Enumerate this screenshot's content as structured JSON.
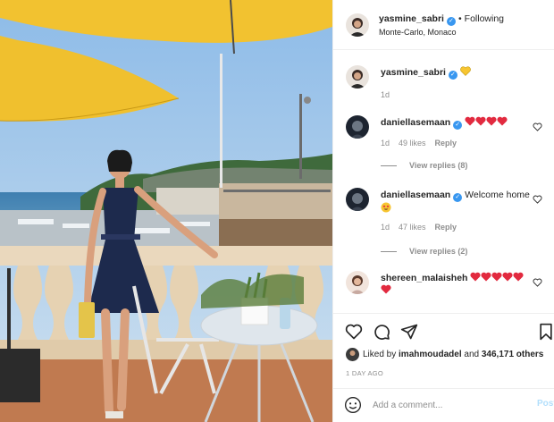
{
  "post": {
    "author": "yasmine_sabri",
    "following_label": "Following",
    "location": "Monte-Carlo, Monaco",
    "caption_emoji": "yellow-heart",
    "caption_time": "1d"
  },
  "comments": [
    {
      "user": "daniellasemaan",
      "text": "",
      "emoji": [
        "red-heart",
        "red-heart",
        "red-heart",
        "red-heart"
      ],
      "time": "1d",
      "likes": "49 likes",
      "reply": "Reply",
      "view_replies": "View replies (8)"
    },
    {
      "user": "daniellasemaan",
      "text": "Welcome home",
      "emoji": [
        "heart-eyes"
      ],
      "time": "1d",
      "likes": "47 likes",
      "reply": "Reply",
      "view_replies": "View replies (2)"
    },
    {
      "user": "shereen_malaisheh",
      "text": "",
      "emoji": [
        "red-heart",
        "red-heart",
        "red-heart",
        "red-heart",
        "red-heart",
        "red-heart"
      ]
    }
  ],
  "actions": {
    "icons": [
      "heart-icon",
      "comment-icon",
      "share-icon",
      "bookmark-icon"
    ],
    "liked_by_prefix": "Liked by",
    "liked_by_user": "imahmoudadel",
    "liked_by_and": "and",
    "liked_by_count": "346,171 others",
    "time_ago": "1 DAY AGO",
    "comment_placeholder": "Add a comment...",
    "post_label": "Post"
  },
  "colors": {
    "verified": "#3897f0",
    "heart": "#ed4956",
    "umbrella": "#f2c230"
  }
}
